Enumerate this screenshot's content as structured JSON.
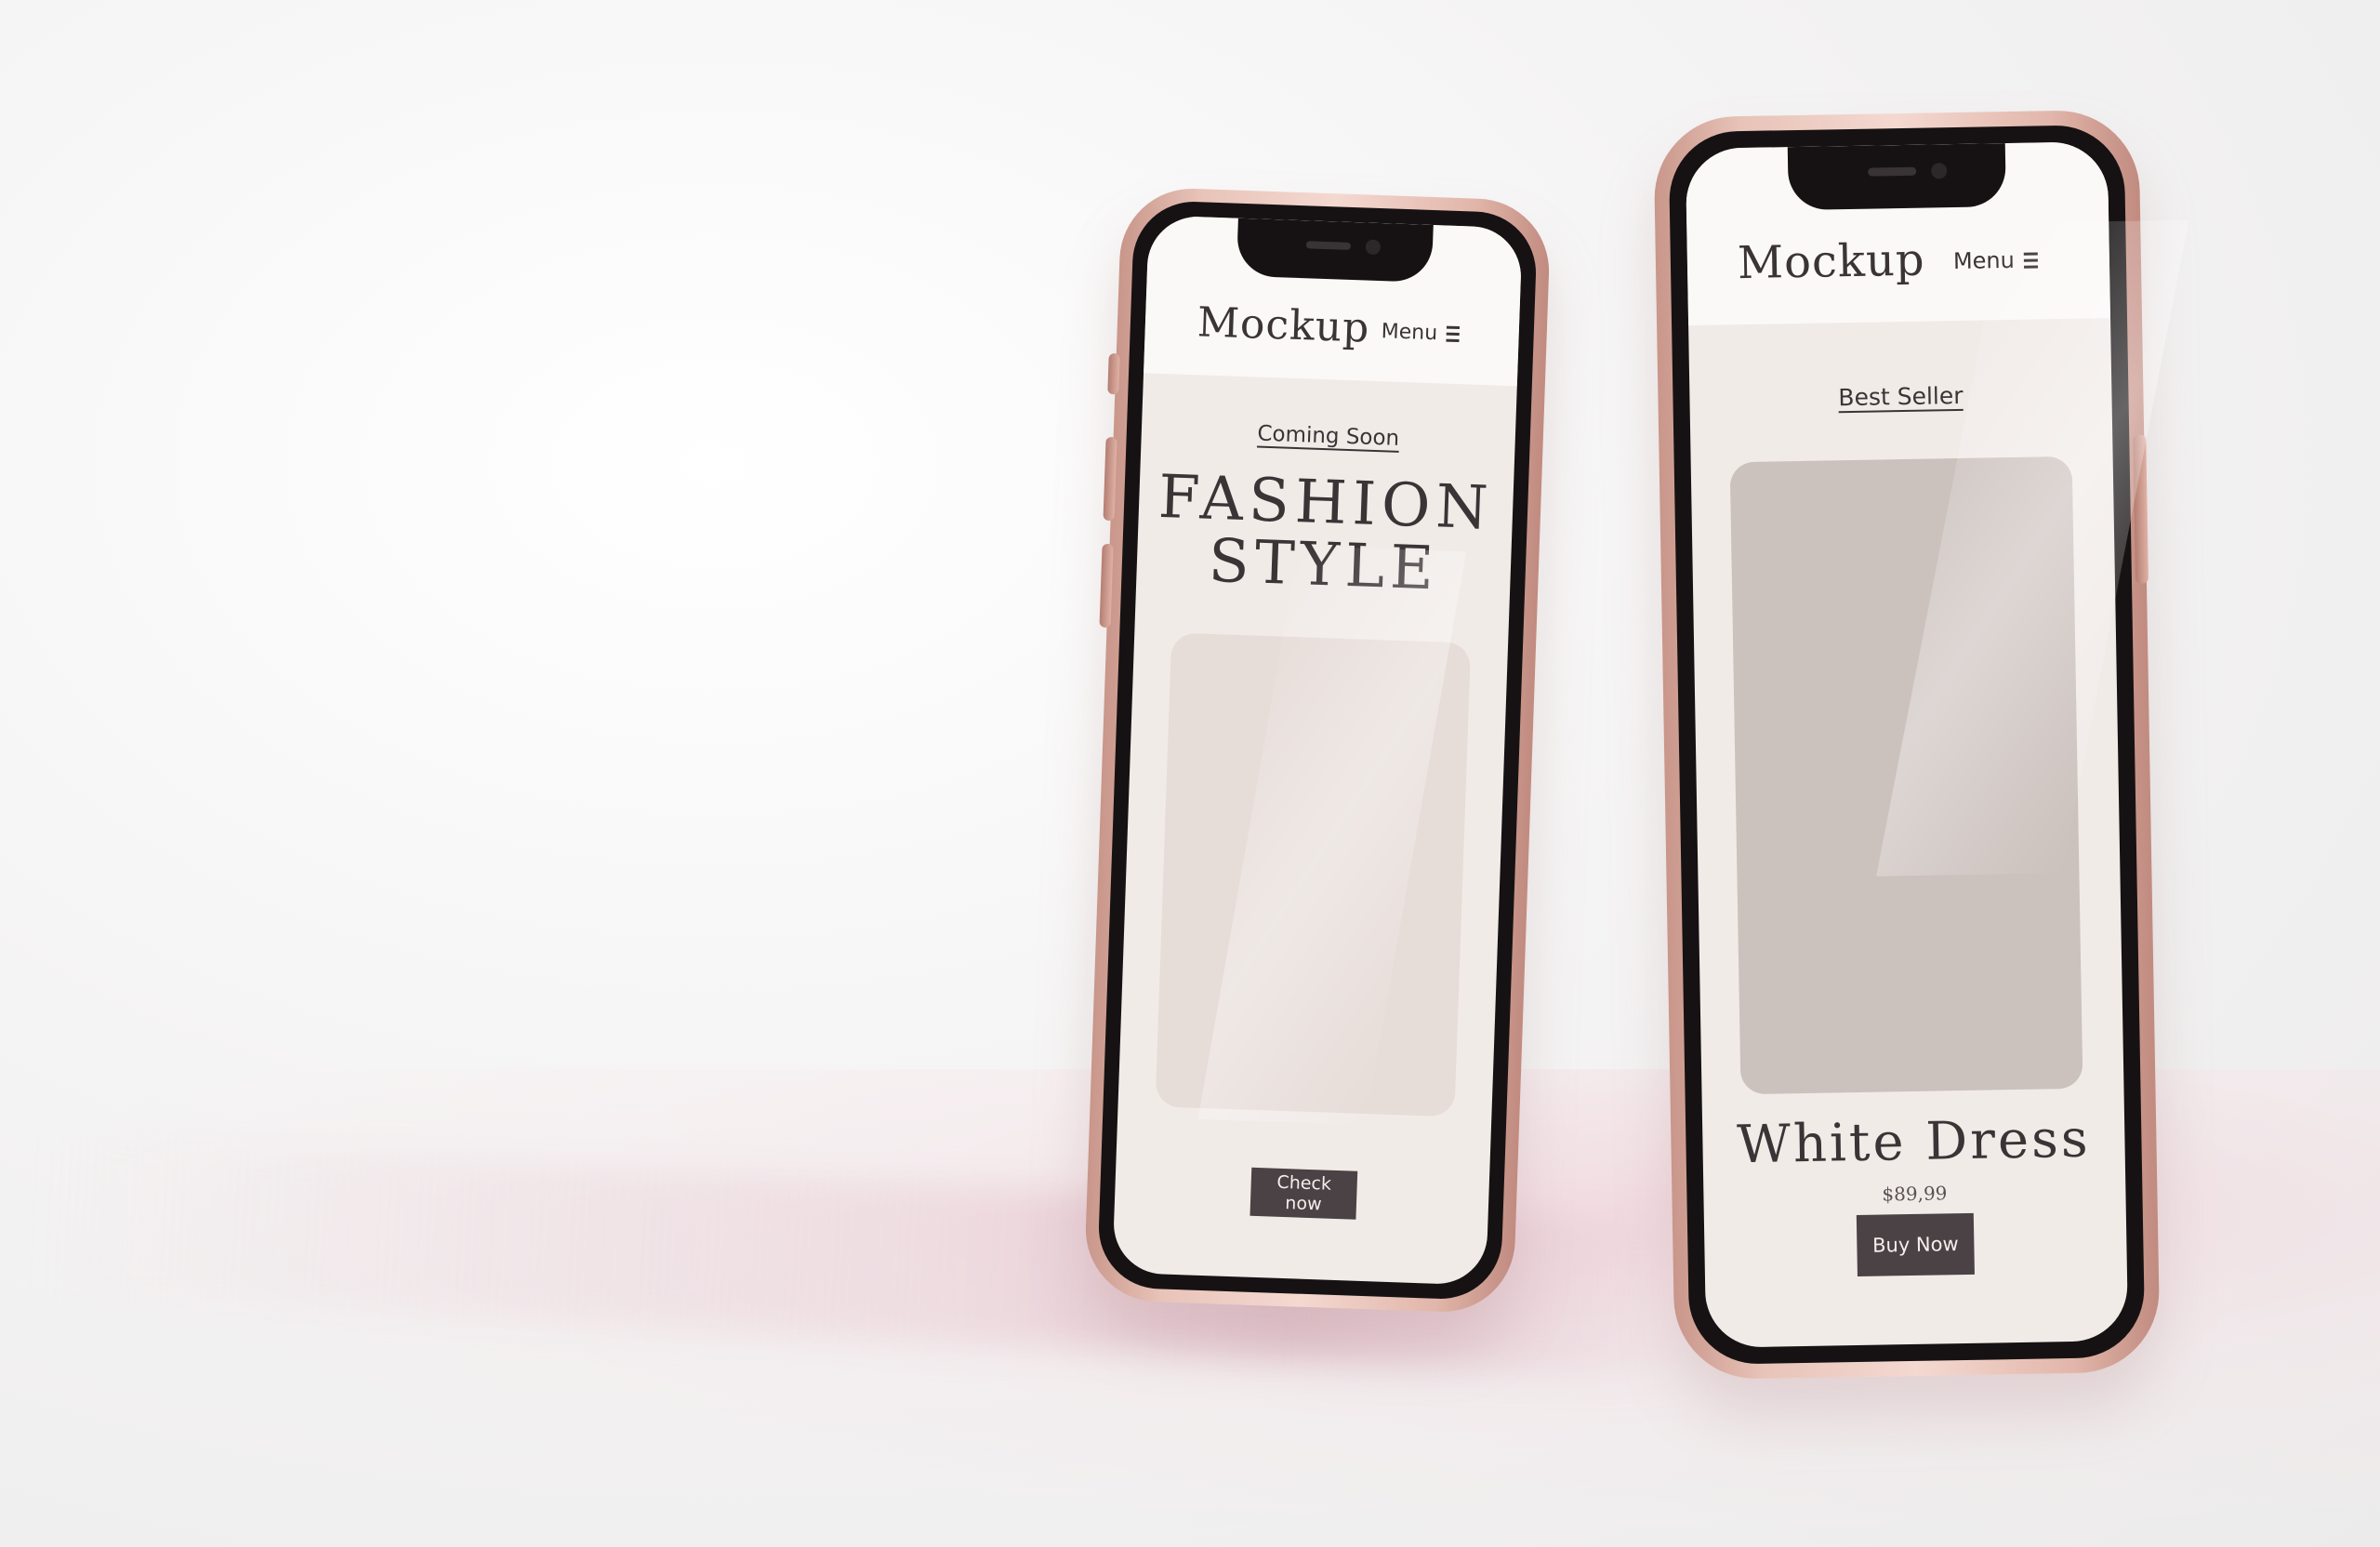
{
  "phone_left": {
    "logo": "Mockup",
    "menu_label": "Menu",
    "eyebrow": "Coming Soon",
    "headline_line1": "FASHION",
    "headline_line2": "STYLE",
    "cta_label": "Check now",
    "image_placeholder_color": "#e6dcd8"
  },
  "phone_right": {
    "logo": "Mockup",
    "menu_label": "Menu",
    "eyebrow": "Best Seller",
    "product_name": "White Dress",
    "price": "$89,99",
    "cta_label": "Buy Now",
    "image_placeholder_color": "#cbc1bd"
  },
  "colors": {
    "frame": "#e8c3b8",
    "screen": "#f1ebe8",
    "header": "#fbf9f8",
    "button": "#4a4244",
    "text": "#3b3436"
  }
}
